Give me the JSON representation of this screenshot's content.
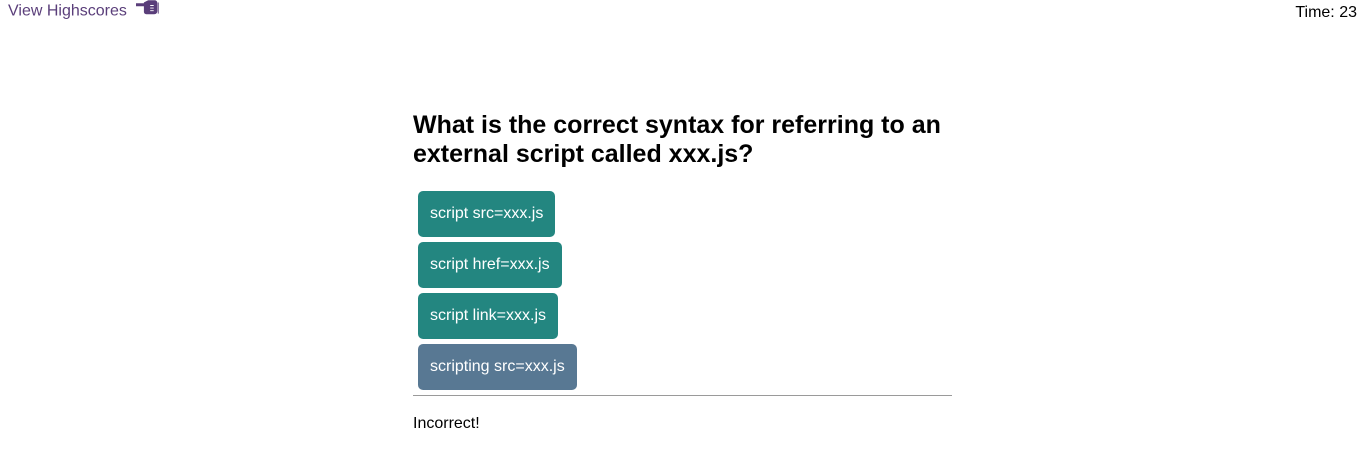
{
  "header": {
    "highscores_label": "View Highscores",
    "highscores_icon": "pointing-hand-icon",
    "timer_text": "Time: 23"
  },
  "quiz": {
    "question": "What is the correct syntax for referring to an external script called xxx.js?",
    "choices": [
      "script src=xxx.js",
      "script href=xxx.js",
      "script link=xxx.js",
      "scripting src=xxx.js"
    ],
    "selected_choice_index": 3,
    "feedback": "Incorrect!"
  },
  "colors": {
    "link": "#5a3e7a",
    "button": "#238680",
    "selected_button": "#587893",
    "divider": "#9a9a9a"
  }
}
